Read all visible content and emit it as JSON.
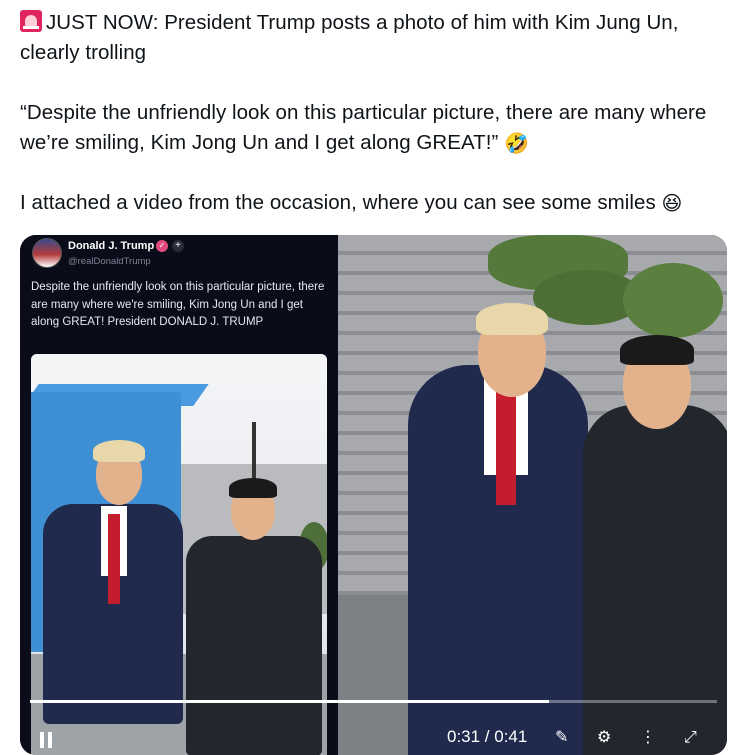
{
  "tweet": {
    "siren_icon": "rotating-light-icon",
    "line1": "JUST NOW: President Trump posts a photo of him with Kim Jung Un, clearly trolling",
    "quote": "“Despite the unfriendly look on this particular picture, there are many where we’re smiling, Kim Jong Un and I get along GREAT!”",
    "quote_emoji": "🤣",
    "line3": "I attached a video from the occasion, where you can see some smiles",
    "line3_emoji": "😆"
  },
  "embedded_post": {
    "name": "Donald J. Trump",
    "handle": "@realDonaldTrump",
    "verified_mark": "✓",
    "follow_mark": "+",
    "body": "Despite the unfriendly look on this particular picture, there are many where we're smiling, Kim Jong Un and I get along GREAT! President DONALD J. TRUMP"
  },
  "video": {
    "time": "0:31 / 0:41",
    "progress": 0.756,
    "icons": [
      "pause-icon",
      "mute-icon",
      "settings-icon",
      "fullscreen-icon"
    ]
  },
  "colors": {
    "text": "#0f1419",
    "post_bg": "#0b0c1a",
    "tie": "#c41e2e"
  }
}
